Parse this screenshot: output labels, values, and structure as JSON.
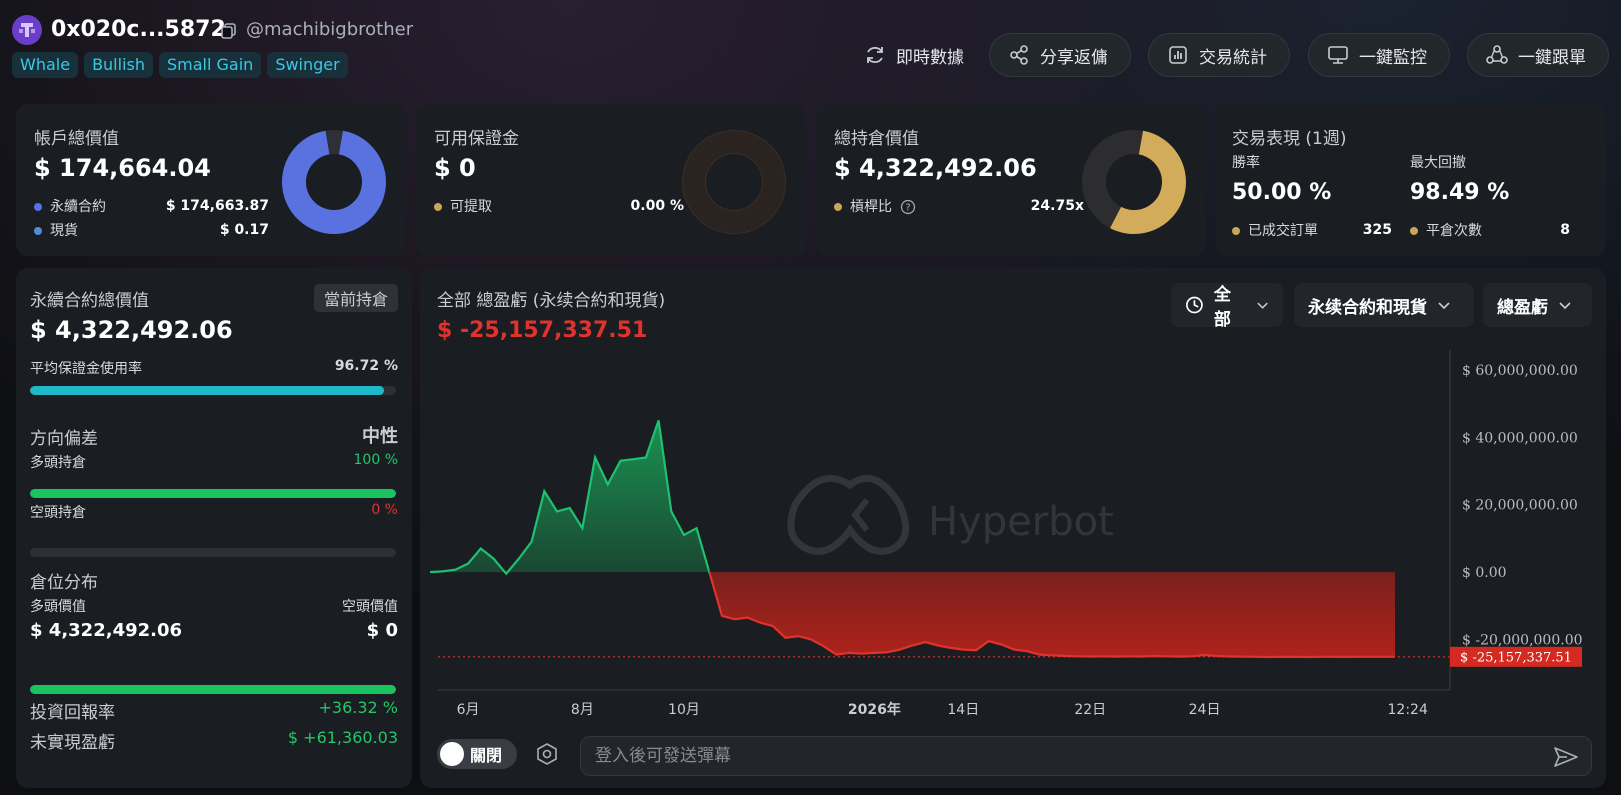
{
  "header": {
    "address": "0x020c...5872",
    "handle": "@machibigbrother",
    "tags": [
      "Whale",
      "Bullish",
      "Small Gain",
      "Swinger"
    ],
    "buttons": {
      "realtime": "即時數據",
      "share": "分享返傭",
      "stats": "交易統計",
      "monitor": "一鍵監控",
      "copytrade": "一鍵跟單"
    }
  },
  "cards": {
    "account": {
      "title": "帳戶總價值",
      "value": "$ 174,664.04",
      "perp_label": "永續合約",
      "perp_value": "$ 174,663.87",
      "spot_label": "現貨",
      "spot_value": "$ 0.17",
      "perp_fraction": 0.999999
    },
    "margin": {
      "title": "可用保證金",
      "value": "$ 0",
      "withdraw_label": "可提取",
      "withdraw_value": "0.00 %",
      "fraction": 0
    },
    "position": {
      "title": "總持倉價值",
      "value": "$ 4,322,492.06",
      "leverage_label": "槓桿比",
      "leverage_value": "24.75x",
      "fraction": 0.58
    },
    "performance": {
      "title": "交易表現 (1週)",
      "winrate_label": "勝率",
      "winrate_value": "50.00 %",
      "drawdown_label": "最大回撤",
      "drawdown_value": "98.49 %",
      "orders_label": "已成交訂單",
      "orders_value": "325",
      "close_label": "平倉次數",
      "close_value": "8"
    }
  },
  "left": {
    "perp_total_label": "永續合約總價值",
    "current_position_btn": "當前持倉",
    "perp_total_value": "$ 4,322,492.06",
    "margin_usage_label": "平均保證金使用率",
    "margin_usage_value": "96.72 %",
    "margin_usage_fraction": 0.9672,
    "bias_label": "方向偏差",
    "bias_value": "中性",
    "long_label": "多頭持倉",
    "long_value": "100 %",
    "long_fraction": 1.0,
    "short_label": "空頭持倉",
    "short_value": "0 %",
    "short_fraction": 0,
    "dist_label": "倉位分布",
    "long_val_label": "多頭價值",
    "short_val_label": "空頭價值",
    "long_val": "$ 4,322,492.06",
    "short_val": "$ 0",
    "dist_long_fraction": 1.0,
    "roi_label": "投資回報率",
    "roi_value": "+36.32 %",
    "upnl_label": "未實現盈虧",
    "upnl_value": "$ +61,360.03"
  },
  "chart": {
    "title": "全部 總盈虧 (永续合約和現貨)",
    "value": "$ -25,157,337.51",
    "dropdowns": [
      "全部",
      "永续合約和現貨",
      "總盈虧"
    ],
    "watermark": "Hyperbot",
    "current_label": "$ -25,157,337.51",
    "toggle_label": "關閉",
    "message_placeholder": "登入後可發送彈幕"
  },
  "chart_data": {
    "type": "area",
    "title": "全部 總盈虧 (永续合約和現貨)",
    "x_ticks": [
      "6月",
      "8月",
      "10月",
      "2026年",
      "14日",
      "22日",
      "24日",
      "12:24"
    ],
    "y_ticks": [
      "$ 60,000,000.00",
      "$ 40,000,000.00",
      "$ 20,000,000.00",
      "$ 0.00",
      "$ -20,000,000.00"
    ],
    "ylim": [
      -35000000,
      65000000
    ],
    "y_tick_values": [
      60000000,
      40000000,
      20000000,
      0,
      -20000000
    ],
    "x_tick_index": [
      3,
      12,
      20,
      35,
      42,
      52,
      61,
      77
    ],
    "current_value": -25157337.51,
    "series": [
      {
        "values": [
          0,
          200000,
          700000,
          2500000,
          7000000,
          4000000,
          -500000,
          4000000,
          9000000,
          24000000,
          18000000,
          19000000,
          13000000,
          34000000,
          26000000,
          33000000,
          33500000,
          34000000,
          45000000,
          18000000,
          11000000,
          13000000,
          0,
          -13000000,
          -14000000,
          -13500000,
          -15000000,
          -16000000,
          -19500000,
          -19000000,
          -20000000,
          -22000000,
          -24500000,
          -24000000,
          -24200000,
          -24000000,
          -23800000,
          -23000000,
          -21800000,
          -20800000,
          -21800000,
          -22500000,
          -23000000,
          -23200000,
          -20500000,
          -21500000,
          -23000000,
          -23500000,
          -24500000,
          -24700000,
          -24900000,
          -25000000,
          -25050000,
          -25000000,
          -25100000,
          -25000000,
          -25050000,
          -24900000,
          -25000000,
          -25100000,
          -25000000,
          -24600000,
          -24900000,
          -25050000,
          -25100000,
          -25150000,
          -25200000,
          -25180000,
          -25160000,
          -25200000,
          -25150000,
          -25160000,
          -25170000,
          -25160000,
          -25150000,
          -25160000,
          -25157337
        ]
      }
    ]
  }
}
